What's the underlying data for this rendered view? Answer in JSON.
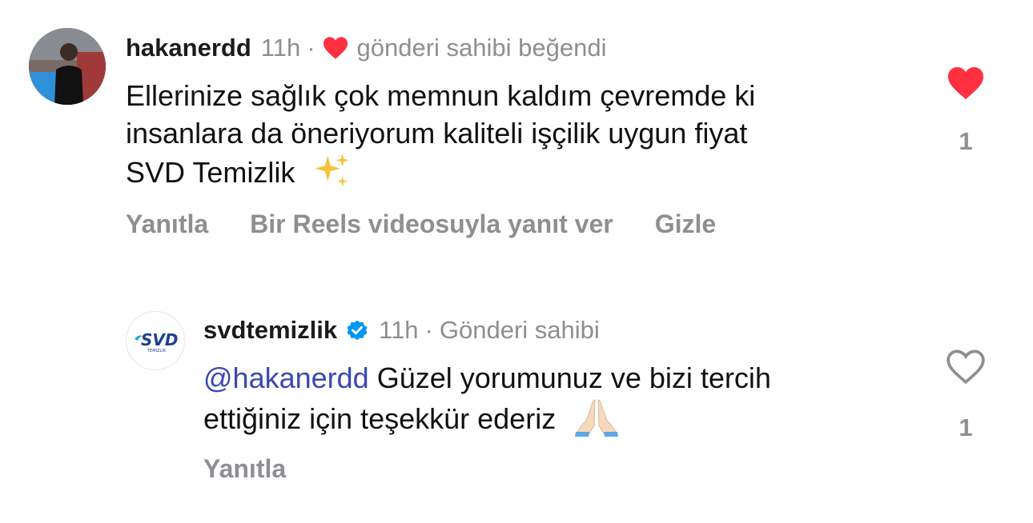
{
  "comments": [
    {
      "username": "hakanerdd",
      "time": "11h",
      "separator": "·",
      "owner_note": "gönderi sahibi beğendi",
      "lines": [
        "Ellerinize sağlık çok memnun kaldım çevremde ki",
        "insanlara da öneriyorum kaliteli işçilik uygun fiyat",
        "SVD Temizlik"
      ],
      "emoji_icon": "sparkles-icon",
      "liked": true,
      "like_count": "1",
      "actions": [
        "Yanıtla",
        "Bir Reels videosuyla yanıt ver",
        "Gizle"
      ]
    },
    {
      "username": "svdtemizlik",
      "verified": true,
      "time": "11h",
      "separator": "·",
      "owner_note": "Gönderi sahibi",
      "mention": "@hakanerdd",
      "lines": [
        "Güzel yorumunuz ve bizi tercih",
        "ettiğiniz için teşekkür ederiz"
      ],
      "emoji_icon": "folded-hands-icon",
      "liked": false,
      "like_count": "1",
      "actions": [
        "Yanıtla"
      ],
      "avatar_logo_text": "SVD",
      "avatar_logo_subtext": "TEMIZLIK"
    }
  ],
  "colors": {
    "like_red": "#ff3040",
    "mention_blue": "#3a47b6",
    "muted_gray": "#8e8e93",
    "verified_blue": "#0095f6"
  }
}
